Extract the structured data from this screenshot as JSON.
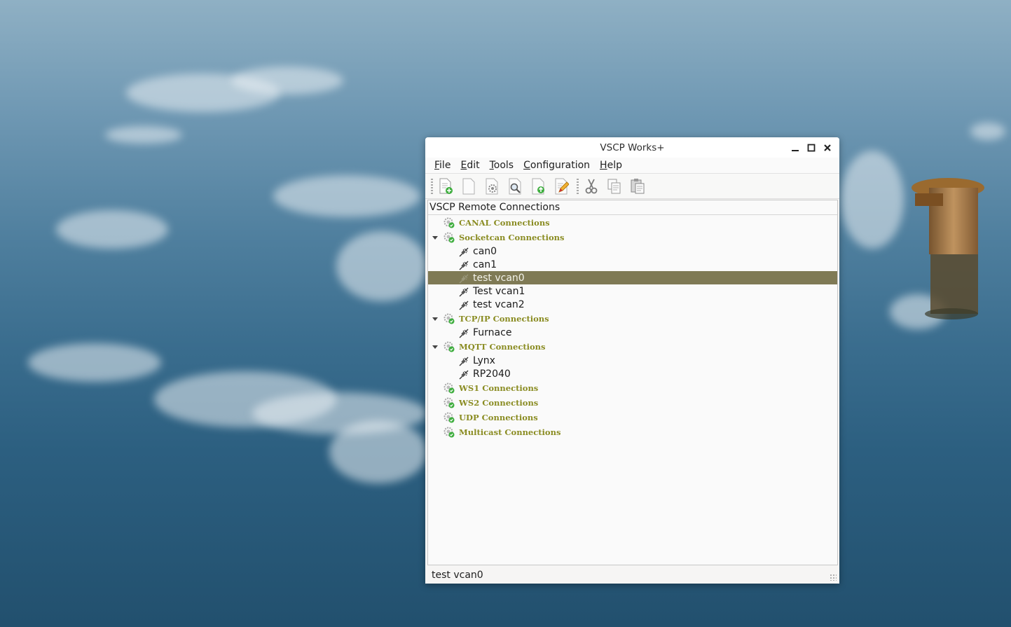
{
  "window": {
    "title": "VSCP Works+",
    "controls": {
      "minimize_icon": "minimize-icon",
      "maximize_icon": "maximize-icon",
      "close_icon": "close-icon"
    }
  },
  "menubar": {
    "items": [
      {
        "label": "File",
        "mnemonic": "F",
        "rest": "ile"
      },
      {
        "label": "Edit",
        "mnemonic": "E",
        "rest": "dit"
      },
      {
        "label": "Tools",
        "mnemonic": "T",
        "rest": "ools"
      },
      {
        "label": "Configuration",
        "mnemonic": "C",
        "rest": "onfiguration"
      },
      {
        "label": "Help",
        "mnemonic": "H",
        "rest": "elp"
      }
    ]
  },
  "toolbar": {
    "icons": [
      "new-connection-icon",
      "blank-document-icon",
      "settings-document-icon",
      "search-document-icon",
      "upload-document-icon",
      "edit-document-icon",
      "cut-icon",
      "copy-icon",
      "paste-icon"
    ]
  },
  "panel": {
    "title": "VSCP Remote Connections",
    "categories": [
      {
        "label": "CANAL Connections",
        "expanded": false,
        "children": []
      },
      {
        "label": "Socketcan Connections",
        "expanded": true,
        "children": [
          "can0",
          "can1",
          "test vcan0",
          "Test vcan1",
          "test vcan2"
        ]
      },
      {
        "label": "TCP/IP Connections",
        "expanded": true,
        "children": [
          "Furnace"
        ]
      },
      {
        "label": "MQTT Connections",
        "expanded": true,
        "children": [
          "Lynx",
          "RP2040"
        ]
      },
      {
        "label": "WS1 Connections",
        "expanded": false,
        "children": []
      },
      {
        "label": "WS2 Connections",
        "expanded": false,
        "children": []
      },
      {
        "label": "UDP Connections",
        "expanded": false,
        "children": []
      },
      {
        "label": "Multicast Connections",
        "expanded": false,
        "children": []
      }
    ],
    "selected": "test vcan0"
  },
  "status": {
    "text": "test vcan0"
  },
  "colors": {
    "category_text": "#8a8c22",
    "selection": "#7f7a55",
    "check_green": "#3fae3f"
  }
}
